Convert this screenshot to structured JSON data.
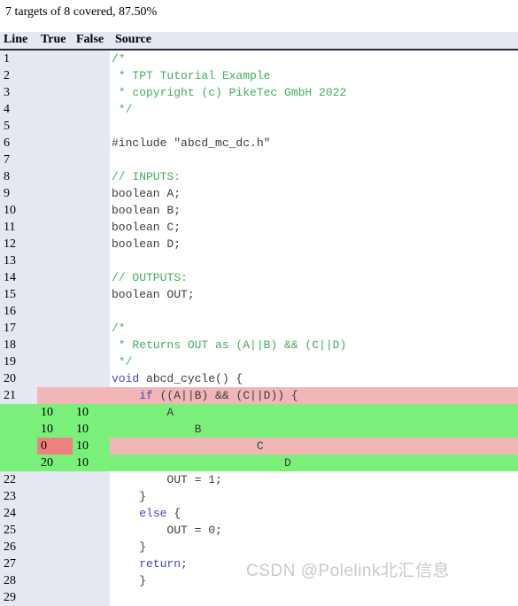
{
  "summary": {
    "text": "7 targets of 8 covered, 87.50%",
    "covered": 7,
    "total": 8,
    "percent": "87.50%"
  },
  "table": {
    "headers": {
      "line": "Line",
      "true": "True",
      "false": "False",
      "source": "Source"
    }
  },
  "colors": {
    "covered": "#79F079",
    "uncovered": "#F2B6B6",
    "uncovered_strong": "#F08080",
    "gutter": "#E4E8F0",
    "comment": "#3FAF5F",
    "keyword": "#4444CC",
    "plain": "#3b3b42"
  },
  "rows": [
    {
      "line": "1",
      "true": "",
      "false": "",
      "state": "none",
      "src_html": "<span class=\"cmt\">/*</span>"
    },
    {
      "line": "2",
      "true": "",
      "false": "",
      "state": "none",
      "src_html": "<span class=\"cmt\"> * TPT Tutorial Example</span>"
    },
    {
      "line": "3",
      "true": "",
      "false": "",
      "state": "none",
      "src_html": "<span class=\"cmt\"> * copyright (c) PikeTec GmbH 2022</span>"
    },
    {
      "line": "4",
      "true": "",
      "false": "",
      "state": "none",
      "src_html": "<span class=\"cmt\"> */</span>"
    },
    {
      "line": "5",
      "true": "",
      "false": "",
      "state": "none",
      "src_html": ""
    },
    {
      "line": "6",
      "true": "",
      "false": "",
      "state": "none",
      "src_html": "<span class=\"pp\">#include \"abcd_mc_dc.h\"</span>"
    },
    {
      "line": "7",
      "true": "",
      "false": "",
      "state": "none",
      "src_html": ""
    },
    {
      "line": "8",
      "true": "",
      "false": "",
      "state": "none",
      "src_html": "<span class=\"cmt\">// INPUTS:</span>"
    },
    {
      "line": "9",
      "true": "",
      "false": "",
      "state": "none",
      "src_html": "<span class=\"pl\">boolean A;</span>"
    },
    {
      "line": "10",
      "true": "",
      "false": "",
      "state": "none",
      "src_html": "<span class=\"pl\">boolean B;</span>"
    },
    {
      "line": "11",
      "true": "",
      "false": "",
      "state": "none",
      "src_html": "<span class=\"pl\">boolean C;</span>"
    },
    {
      "line": "12",
      "true": "",
      "false": "",
      "state": "none",
      "src_html": "<span class=\"pl\">boolean D;</span>"
    },
    {
      "line": "13",
      "true": "",
      "false": "",
      "state": "none",
      "src_html": ""
    },
    {
      "line": "14",
      "true": "",
      "false": "",
      "state": "none",
      "src_html": "<span class=\"cmt\">// OUTPUTS:</span>"
    },
    {
      "line": "15",
      "true": "",
      "false": "",
      "state": "none",
      "src_html": "<span class=\"pl\">boolean OUT;</span>"
    },
    {
      "line": "16",
      "true": "",
      "false": "",
      "state": "none",
      "src_html": ""
    },
    {
      "line": "17",
      "true": "",
      "false": "",
      "state": "none",
      "src_html": "<span class=\"cmt\">/*</span>"
    },
    {
      "line": "18",
      "true": "",
      "false": "",
      "state": "none",
      "src_html": "<span class=\"cmt\"> * Returns OUT as (A||B) &amp;&amp; (C||D)</span>"
    },
    {
      "line": "19",
      "true": "",
      "false": "",
      "state": "none",
      "src_html": "<span class=\"cmt\"> */</span>"
    },
    {
      "line": "20",
      "true": "",
      "false": "",
      "state": "none",
      "src_html": "<span class=\"kw\">void</span><span class=\"pl\"> abcd_cycle() {</span>"
    },
    {
      "line": "21",
      "true": "",
      "false": "",
      "state": "cond-red",
      "src_html": "<span class=\"pl\">    </span><span class=\"kw\">if</span><span class=\"pl\"> ((A||B) &amp;&amp; (C||D)) {</span>"
    },
    {
      "line": "",
      "true": "10",
      "false": "10",
      "state": "cov-green",
      "src_html": "<span class=\"pl\">        A</span>",
      "condition": "A"
    },
    {
      "line": "",
      "true": "10",
      "false": "10",
      "state": "cov-green",
      "src_html": "<span class=\"pl\">            B</span>",
      "condition": "B"
    },
    {
      "line": "",
      "true": "0",
      "false": "10",
      "state": "cov-red",
      "src_html": "<span class=\"pl\">                     C</span>",
      "condition": "C"
    },
    {
      "line": "",
      "true": "20",
      "false": "10",
      "state": "cov-green",
      "src_html": "<span class=\"pl\">                         D</span>",
      "condition": "D"
    },
    {
      "line": "22",
      "true": "",
      "false": "",
      "state": "none",
      "src_html": "<span class=\"pl\">        OUT = 1;</span>"
    },
    {
      "line": "23",
      "true": "",
      "false": "",
      "state": "none",
      "src_html": "<span class=\"pl\">    }</span>"
    },
    {
      "line": "24",
      "true": "",
      "false": "",
      "state": "none",
      "src_html": "<span class=\"pl\">    </span><span class=\"kw\">else</span><span class=\"pl\"> {</span>"
    },
    {
      "line": "25",
      "true": "",
      "false": "",
      "state": "none",
      "src_html": "<span class=\"pl\">        OUT = 0;</span>"
    },
    {
      "line": "26",
      "true": "",
      "false": "",
      "state": "none",
      "src_html": "<span class=\"pl\">    }</span>"
    },
    {
      "line": "27",
      "true": "",
      "false": "",
      "state": "none",
      "src_html": "<span class=\"pl\">    </span><span class=\"kw\">return</span><span class=\"pl\">;</span>"
    },
    {
      "line": "28",
      "true": "",
      "false": "",
      "state": "none",
      "src_html": "<span class=\"pl\">    }</span>"
    },
    {
      "line": "29",
      "true": "",
      "false": "",
      "state": "none",
      "src_html": ""
    }
  ],
  "watermark": {
    "text": "CSDN @Polelink北汇信息"
  }
}
